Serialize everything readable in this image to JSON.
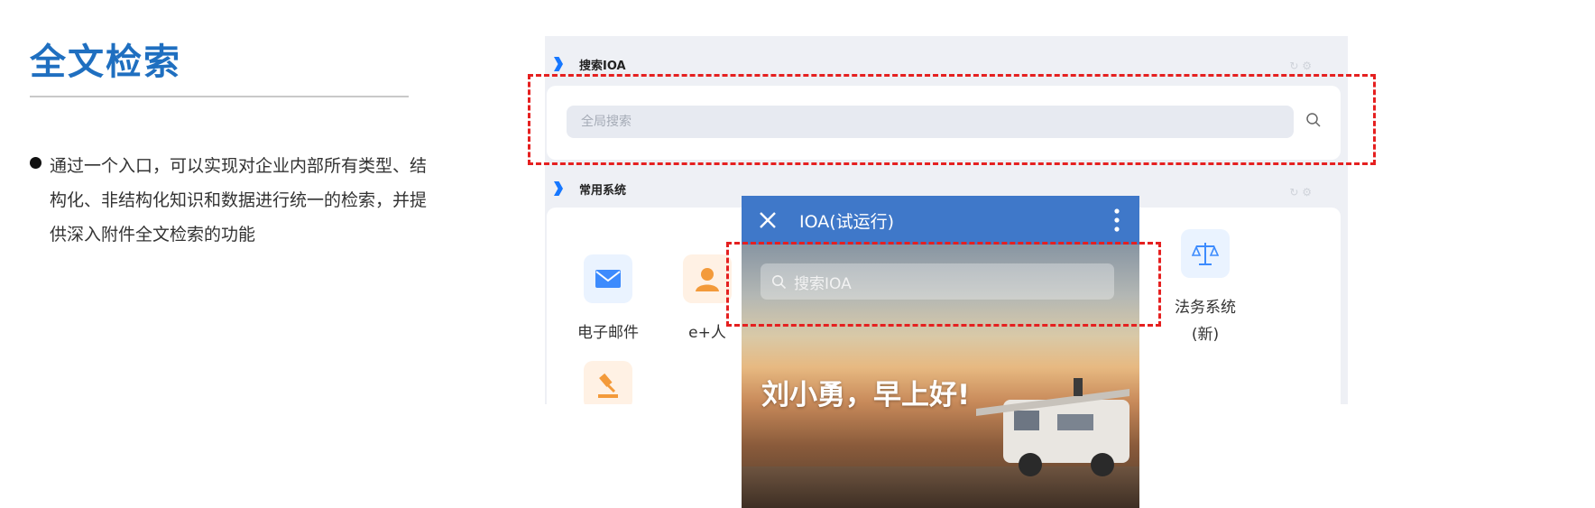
{
  "slide": {
    "title": "全文检索",
    "bullet": "通过一个入口，可以实现对企业内部所有类型、结构化、非结构化知识和数据进行统一的检索，并提供深入附件全文检索的功能"
  },
  "desktop": {
    "search_section": {
      "title": "搜索IOA",
      "tools": "↻ ⚙"
    },
    "search_input": {
      "placeholder": "全局搜索"
    },
    "apps_section": {
      "title": "常用系统",
      "tools": "↻ ⚙"
    },
    "apps": [
      {
        "label": "电子邮件",
        "icon": "mail-icon",
        "bg": "#eaf3ff",
        "color": "#3d8bfd"
      },
      {
        "label": "e+人",
        "icon": "person-icon",
        "bg": "#fff1e4",
        "color": "#f39a3a"
      },
      {
        "label": "法务系统\n(新)",
        "icon": "scales-icon",
        "bg": "#eaf3ff",
        "color": "#3d8bfd"
      },
      {
        "label": "",
        "icon": "gavel-icon",
        "bg": "#fff1e4",
        "color": "#f39a3a"
      }
    ]
  },
  "mobile": {
    "header_title": "IOA(试运行)",
    "search_placeholder": "搜索IOA",
    "greeting": "刘小勇，早上好!"
  },
  "colors": {
    "title_blue": "#1f6fc0",
    "highlight_red": "#e52020",
    "mobile_header": "#3f78c9"
  }
}
